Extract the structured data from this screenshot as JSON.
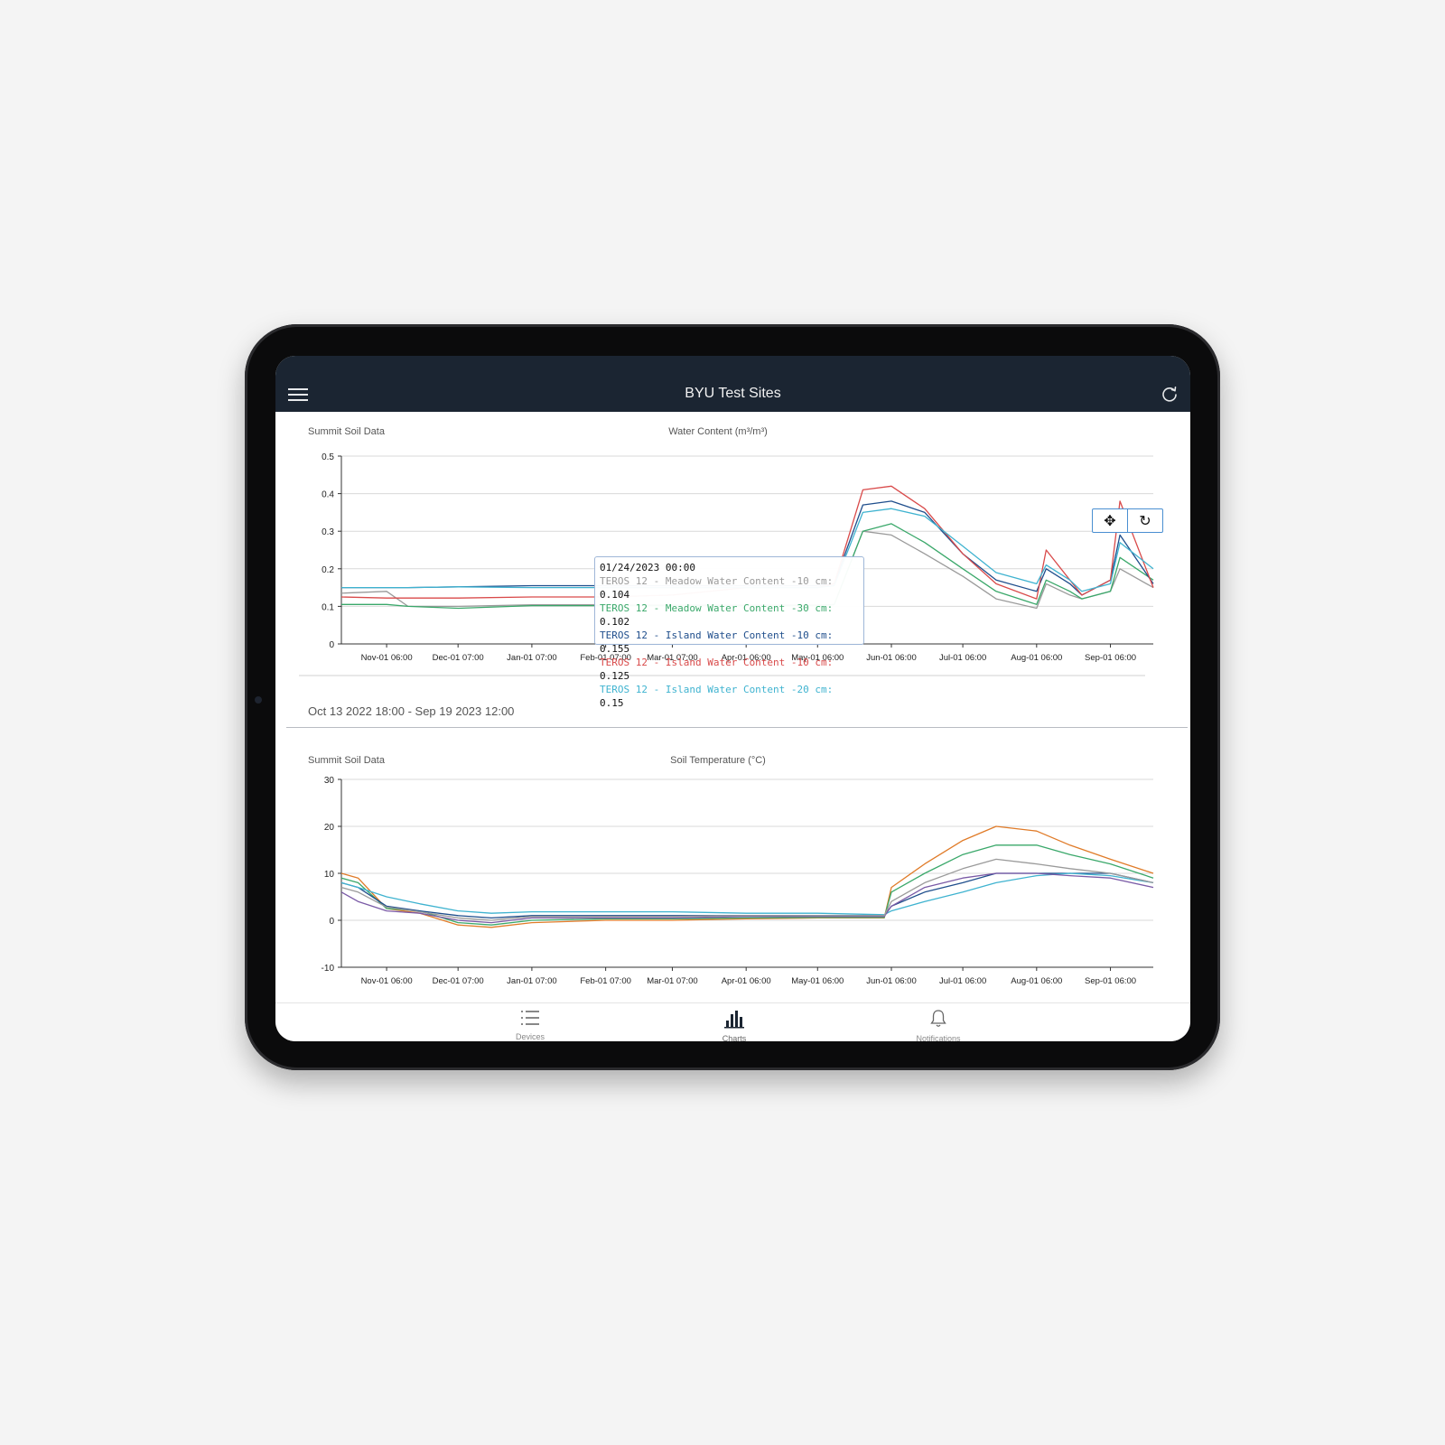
{
  "header": {
    "title": "BYU Test Sites"
  },
  "icons": {
    "menu": "hamburger-icon",
    "refresh": "refresh-icon",
    "pan": "pan-icon",
    "reset": "reset-zoom-icon"
  },
  "colors": {
    "header_bg": "#1b2532",
    "meadow10": "#9a9a9a",
    "meadow30": "#3aa86a",
    "island10": "#1f4e8c",
    "island10red": "#d94a4a",
    "island20": "#3fb3d0",
    "orange": "#e07b28",
    "purple": "#7a5aa6"
  },
  "water_chart": {
    "site_label": "Summit Soil Data",
    "title": "Water Content (m³/m³)",
    "range_text": "Oct 13 2022 18:00 - Sep 19 2023 12:00",
    "tooltip": {
      "date": "01/24/2023 00:00",
      "rows": [
        {
          "label": "TEROS 12 - Meadow Water Content -10 cm:",
          "value": "0.104",
          "color": "#9a9a9a"
        },
        {
          "label": "TEROS 12 - Meadow Water Content -30 cm:",
          "value": "0.102",
          "color": "#3aa86a"
        },
        {
          "label": "TEROS 12 - Island Water Content -10 cm:",
          "value": "0.155",
          "color": "#1f4e8c"
        },
        {
          "label": "TEROS 12 - Island Water Content -10 cm:",
          "value": "0.125",
          "color": "#d94a4a"
        },
        {
          "label": "TEROS 12 - Island Water Content -20 cm:",
          "value": "0.15",
          "color": "#3fb3d0"
        }
      ]
    }
  },
  "temp_chart": {
    "site_label": "Summit Soil Data",
    "title": "Soil Temperature (°C)"
  },
  "tabs": [
    {
      "label": "Devices",
      "icon": "list-icon"
    },
    {
      "label": "Charts",
      "icon": "bar-chart-icon"
    },
    {
      "label": "Notifications",
      "icon": "bell-icon"
    }
  ],
  "chart_data": [
    {
      "type": "line",
      "title": "Water Content (m³/m³)",
      "subtitle": "Summit Soil Data",
      "x_ticks": [
        "Nov-01 06:00",
        "Dec-01 07:00",
        "Jan-01 07:00",
        "Feb-01 07:00",
        "Mar-01 07:00",
        "Apr-01 06:00",
        "May-01 06:00",
        "Jun-01 06:00",
        "Jul-01 06:00",
        "Aug-01 06:00",
        "Sep-01 06:00"
      ],
      "x": [
        "2022-10-13",
        "2022-11-01",
        "2022-11-10",
        "2022-12-01",
        "2023-01-01",
        "2023-02-01",
        "2023-03-01",
        "2023-04-01",
        "2023-05-01",
        "2023-05-08",
        "2023-05-20",
        "2023-06-01",
        "2023-06-15",
        "2023-07-01",
        "2023-07-15",
        "2023-08-01",
        "2023-08-05",
        "2023-08-15",
        "2023-08-20",
        "2023-09-01",
        "2023-09-05",
        "2023-09-19"
      ],
      "ylim": [
        0,
        0.5
      ],
      "yticks": [
        0,
        0.1,
        0.2,
        0.3,
        0.4,
        0.5
      ],
      "series": [
        {
          "name": "TEROS 12 - Meadow Water Content -10 cm",
          "color": "#9a9a9a",
          "values": [
            0.135,
            0.14,
            0.1,
            0.1,
            0.104,
            0.104,
            0.104,
            0.104,
            0.104,
            0.104,
            0.3,
            0.29,
            0.24,
            0.18,
            0.12,
            0.095,
            0.16,
            0.13,
            0.12,
            0.14,
            0.2,
            0.15
          ]
        },
        {
          "name": "TEROS 12 - Meadow Water Content -30 cm",
          "color": "#3aa86a",
          "values": [
            0.105,
            0.105,
            0.1,
            0.095,
            0.102,
            0.102,
            0.102,
            0.102,
            0.102,
            0.105,
            0.3,
            0.32,
            0.27,
            0.2,
            0.14,
            0.105,
            0.17,
            0.14,
            0.12,
            0.14,
            0.23,
            0.17
          ]
        },
        {
          "name": "TEROS 12 - Island Water Content -10 cm",
          "color": "#1f4e8c",
          "values": [
            0.15,
            0.15,
            0.15,
            0.152,
            0.155,
            0.155,
            0.155,
            0.155,
            0.155,
            0.16,
            0.37,
            0.38,
            0.35,
            0.24,
            0.17,
            0.14,
            0.2,
            0.16,
            0.13,
            0.17,
            0.29,
            0.16
          ]
        },
        {
          "name": "TEROS 12 - Island Water Content -10 cm",
          "color": "#d94a4a",
          "values": [
            0.125,
            0.122,
            0.122,
            0.122,
            0.125,
            0.125,
            0.13,
            0.15,
            0.15,
            0.16,
            0.41,
            0.42,
            0.36,
            0.24,
            0.16,
            0.12,
            0.25,
            0.17,
            0.13,
            0.17,
            0.38,
            0.15
          ]
        },
        {
          "name": "TEROS 12 - Island Water Content -20 cm",
          "color": "#3fb3d0",
          "values": [
            0.15,
            0.15,
            0.15,
            0.152,
            0.15,
            0.15,
            0.15,
            0.15,
            0.15,
            0.155,
            0.35,
            0.36,
            0.34,
            0.26,
            0.19,
            0.16,
            0.21,
            0.17,
            0.14,
            0.16,
            0.27,
            0.2
          ]
        }
      ]
    },
    {
      "type": "line",
      "title": "Soil Temperature (°C)",
      "subtitle": "Summit Soil Data",
      "x_ticks": [
        "Nov-01 06:00",
        "Dec-01 07:00",
        "Jan-01 07:00",
        "Feb-01 07:00",
        "Mar-01 07:00",
        "Apr-01 06:00",
        "May-01 06:00",
        "Jun-01 06:00",
        "Jul-01 06:00",
        "Aug-01 06:00",
        "Sep-01 06:00"
      ],
      "x": [
        "2022-10-13",
        "2022-10-20",
        "2022-11-01",
        "2022-11-15",
        "2022-12-01",
        "2022-12-15",
        "2023-01-01",
        "2023-02-01",
        "2023-03-01",
        "2023-04-01",
        "2023-05-01",
        "2023-05-29",
        "2023-06-01",
        "2023-06-15",
        "2023-07-01",
        "2023-07-15",
        "2023-08-01",
        "2023-08-15",
        "2023-09-01",
        "2023-09-19"
      ],
      "ylim": [
        -10,
        30
      ],
      "yticks": [
        -10,
        0,
        10,
        20,
        30
      ],
      "series": [
        {
          "color": "#e07b28",
          "values": [
            10,
            9,
            2.5,
            1.5,
            -1,
            -1.5,
            -0.5,
            0,
            0,
            0.3,
            0.5,
            0.5,
            7,
            12,
            17,
            20,
            19,
            16,
            13,
            10
          ]
        },
        {
          "color": "#3aa86a",
          "values": [
            9,
            8,
            2.5,
            2,
            -0.5,
            -1,
            0,
            0.3,
            0.3,
            0.5,
            0.6,
            0.6,
            6,
            10,
            14,
            16,
            16,
            14,
            12,
            9
          ]
        },
        {
          "color": "#1f4e8c",
          "values": [
            8,
            7,
            3,
            2,
            1,
            0.5,
            1,
            1,
            1,
            1,
            1,
            1,
            3,
            6,
            8,
            10,
            10,
            10,
            10,
            8
          ]
        },
        {
          "color": "#3fb3d0",
          "values": [
            8,
            7,
            5,
            3.5,
            2,
            1.5,
            1.8,
            1.8,
            1.8,
            1.5,
            1.5,
            1.2,
            2,
            4,
            6,
            8,
            9.5,
            10,
            9.5,
            8
          ]
        },
        {
          "color": "#7a5aa6",
          "values": [
            6,
            4,
            2,
            1.5,
            0,
            -0.5,
            0.5,
            0.5,
            0.5,
            0.8,
            0.8,
            0.8,
            3,
            7,
            9,
            10,
            10,
            9.5,
            9,
            7
          ]
        },
        {
          "color": "#9a9a9a",
          "values": [
            7,
            6,
            2.8,
            1.8,
            0.5,
            0,
            0.8,
            0.8,
            0.8,
            1,
            1,
            1,
            4,
            8,
            11,
            13,
            12,
            11,
            10,
            8
          ]
        }
      ]
    }
  ]
}
